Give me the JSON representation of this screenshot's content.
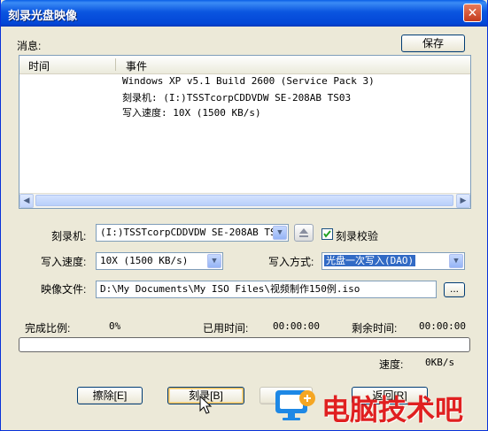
{
  "window": {
    "title": "刻录光盘映像",
    "close_glyph": "✕"
  },
  "messages": {
    "label": "消息:",
    "save_label": "保存",
    "columns": [
      "时间",
      "事件"
    ],
    "rows": [
      "Windows XP v5.1 Build 2600 (Service Pack 3)",
      "刻录机: (I:)TSSTcorpCDDVDW SE-208AB TS03",
      "写入速度: 10X (1500 KB/s)"
    ]
  },
  "burner": {
    "label": "刻录机:",
    "value": "(I:)TSSTcorpCDDVDW SE-208AB TS03",
    "verify_label": "刻录校验",
    "verify_checked": true
  },
  "speed": {
    "label": "写入速度:",
    "value": "10X (1500 KB/s)"
  },
  "method": {
    "label": "写入方式:",
    "value": "光盘一次写入(DAO)"
  },
  "image_file": {
    "label": "映像文件:",
    "value": "D:\\My Documents\\My ISO Files\\视频制作150例.iso",
    "browse_label": "..."
  },
  "progress": {
    "complete_label": "完成比例:",
    "complete_value": "0%",
    "elapsed_label": "已用时间:",
    "elapsed_value": "00:00:00",
    "remaining_label": "剩余时间:",
    "remaining_value": "00:00:00",
    "speed_label": "速度:",
    "speed_value": "0KB/s",
    "fraction": 0
  },
  "buttons": {
    "erase": "擦除[E]",
    "burn": "刻录[B]",
    "cancel": "",
    "return": "返回[R]"
  },
  "watermark": {
    "text": "电脑技术吧"
  },
  "colors": {
    "title_bar": "#0a55e0",
    "face": "#ece9d8",
    "selection": "#316ac5",
    "watermark": "#e02020"
  }
}
